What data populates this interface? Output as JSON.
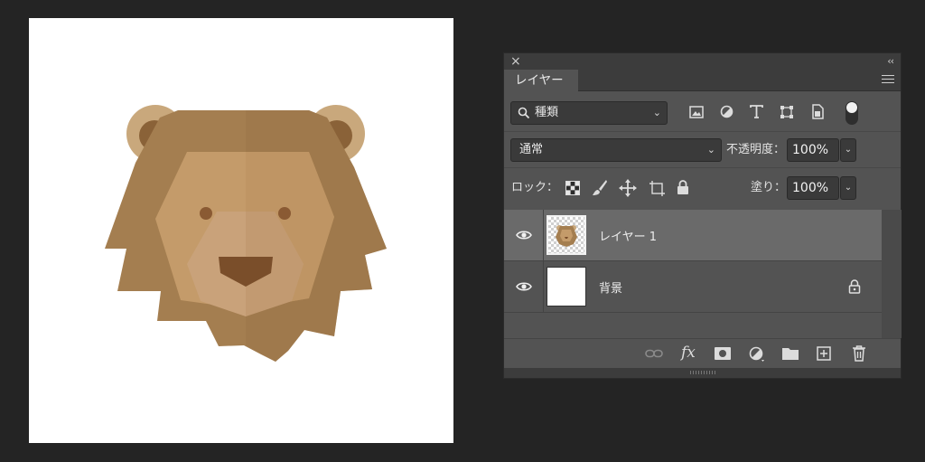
{
  "panel": {
    "close_glyph": "×",
    "collapse_glyph": "‹‹",
    "tab_label": "レイヤー",
    "filter": {
      "value": "種類"
    },
    "blend_mode": {
      "value": "通常"
    },
    "opacity": {
      "label": "不透明度：",
      "value": "100%"
    },
    "lock": {
      "label": "ロック："
    },
    "fill": {
      "label": "塗り：",
      "value": "100%"
    },
    "layers": [
      {
        "name": "レイヤー 1",
        "selected": true,
        "visible": true,
        "locked": false
      },
      {
        "name": "背景",
        "selected": false,
        "visible": true,
        "locked": true
      }
    ],
    "footer": {
      "fx_label": "fx"
    }
  },
  "colors": {
    "app_bg": "#242424",
    "panel_bg": "#535353",
    "selected_row": "#6a6a6a",
    "mane": "#A47E50",
    "face": "#C49B6A",
    "muzzle": "#C9A27A",
    "nose": "#7A4E2A"
  },
  "icons": [
    "close-icon",
    "collapse-icon",
    "panel-menu-icon",
    "search-icon",
    "image-filter-icon",
    "adjustment-filter-icon",
    "type-filter-icon",
    "shape-filter-icon",
    "smart-object-filter-icon",
    "filter-toggle-icon",
    "lock-transparent-icon",
    "lock-image-icon",
    "lock-position-icon",
    "lock-artboard-icon",
    "lock-all-icon",
    "eye-icon",
    "lock-icon",
    "link-icon",
    "layer-mask-icon",
    "adjustment-layer-icon",
    "folder-icon",
    "new-layer-icon",
    "trash-icon"
  ]
}
